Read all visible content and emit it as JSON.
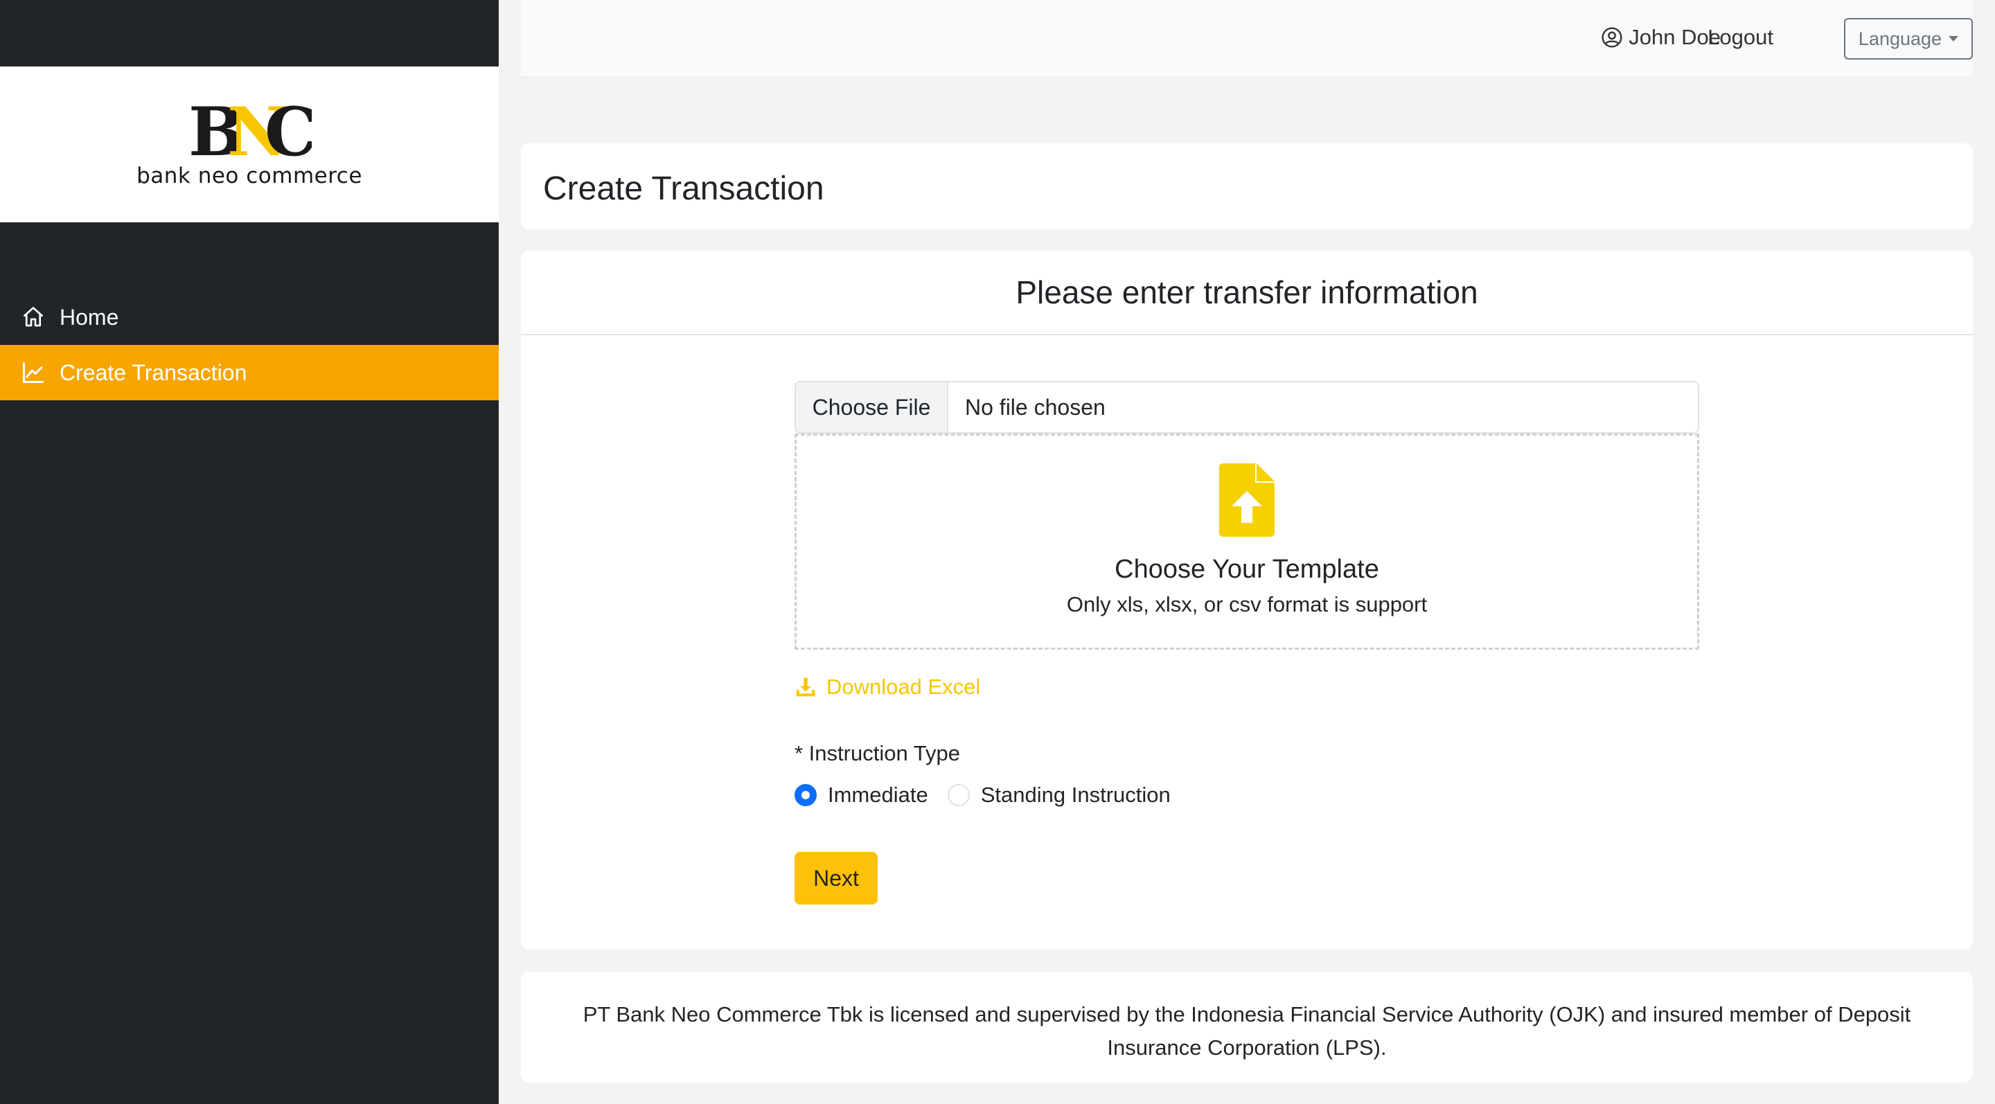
{
  "brand": {
    "logo_letters": "BNC",
    "name": "bank neo commerce",
    "colors": {
      "gold": "#f7c600",
      "dark": "#1a1a1a"
    }
  },
  "sidebar": {
    "items": [
      {
        "label": "Home",
        "icon": "home-icon",
        "active": false
      },
      {
        "label": "Create Transaction",
        "icon": "chart-line-icon",
        "active": true
      }
    ],
    "active_color": "#f7a600",
    "background": "#212529"
  },
  "header": {
    "user_name": "John Doe",
    "user_icon": "user-circle-icon",
    "logout_label": "Logout",
    "language_label": "Language"
  },
  "page": {
    "title": "Create Transaction"
  },
  "form": {
    "heading": "Please enter transfer information",
    "file_input": {
      "button_label": "Choose File",
      "status": "No file chosen"
    },
    "dropzone": {
      "icon": "file-upload-icon",
      "title": "Choose Your Template",
      "subtitle": "Only xls, xlsx, or csv format is support"
    },
    "download_label": "Download Excel",
    "instruction_type": {
      "label": "* Instruction Type",
      "options": [
        {
          "label": "Immediate",
          "checked": true
        },
        {
          "label": "Standing Instruction",
          "checked": false
        }
      ]
    },
    "next_label": "Next"
  },
  "footer": {
    "text": "PT Bank Neo Commerce Tbk is licensed and supervised by the Indonesia Financial Service Authority (OJK) and insured member of Deposit Insurance Corporation (LPS)."
  }
}
